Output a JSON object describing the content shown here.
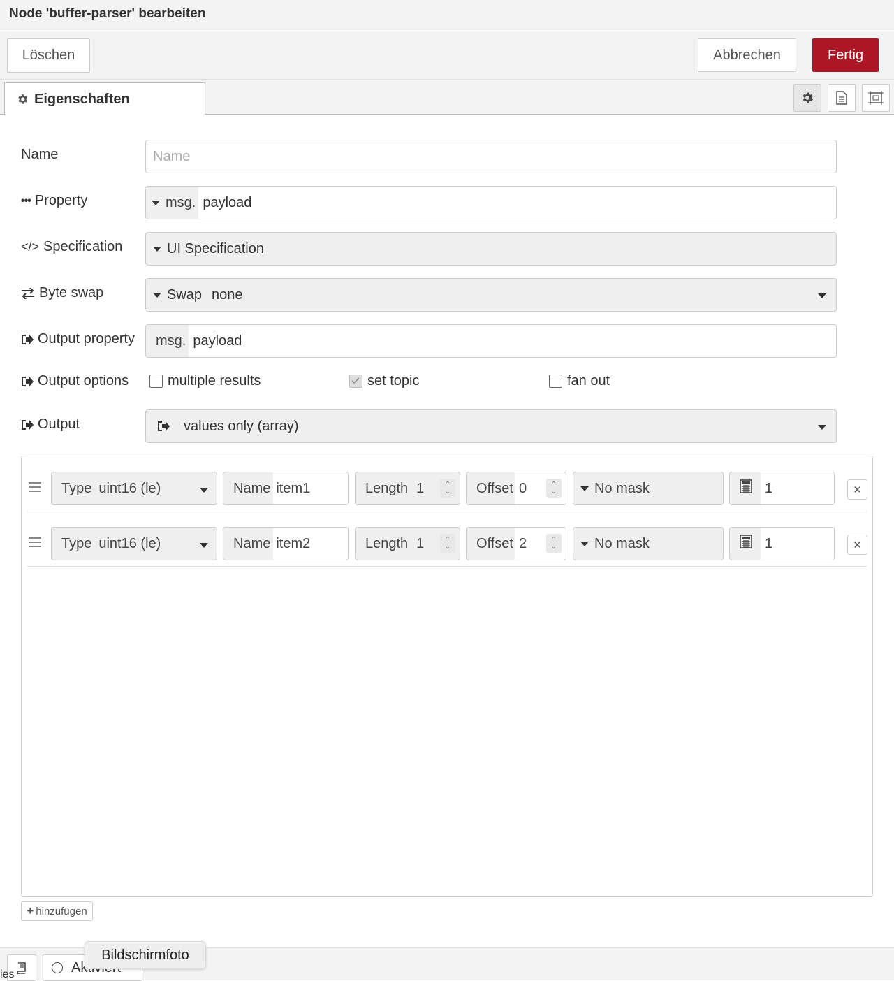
{
  "window": {
    "title": "Node 'buffer-parser' bearbeiten"
  },
  "toolbar": {
    "delete_label": "Löschen",
    "cancel_label": "Abbrechen",
    "done_label": "Fertig"
  },
  "tabs": {
    "properties_label": "Eigenschaften"
  },
  "form": {
    "name": {
      "label": "Name",
      "placeholder": "Name",
      "value": ""
    },
    "property": {
      "label": "Property",
      "prefix": "msg.",
      "value": "payload"
    },
    "specification": {
      "label": "Specification",
      "value": "UI Specification"
    },
    "byte_swap": {
      "label": "Byte swap",
      "prefix": "Swap",
      "value": "none"
    },
    "output_property": {
      "label": "Output property",
      "prefix": "msg.",
      "value": "payload"
    },
    "output_options": {
      "label": "Output options",
      "multiple_results": {
        "label": "multiple results",
        "checked": false
      },
      "set_topic": {
        "label": "set topic",
        "checked": true
      },
      "fan_out": {
        "label": "fan out",
        "checked": false
      }
    },
    "output": {
      "label": "Output",
      "value": "values only (array)"
    }
  },
  "items": [
    {
      "type_label": "Type",
      "type_value": "uint16 (le)",
      "name_label": "Name",
      "name_value": "item1",
      "length_label": "Length",
      "length_value": "1",
      "offset_label": "Offset",
      "offset_value": "0",
      "mask_value": "No mask",
      "scale_value": "1"
    },
    {
      "type_label": "Type",
      "type_value": "uint16 (le)",
      "name_label": "Name",
      "name_value": "item2",
      "length_label": "Length",
      "length_value": "1",
      "offset_label": "Offset",
      "offset_value": "2",
      "mask_value": "No mask",
      "scale_value": "1"
    }
  ],
  "list": {
    "add_label": "hinzufügen"
  },
  "footer": {
    "left_fragment": "ies",
    "status_label": "Aktiviert",
    "tooltip": "Bildschirmfoto"
  },
  "colors": {
    "primary": "#ad1625",
    "panel_bg": "#f3f3f3",
    "border": "#cccccc"
  },
  "icons": [
    "gear-icon",
    "document-icon",
    "frame-icon",
    "ellipsis-icon",
    "code-icon",
    "swap-arrows-icon",
    "output-arrow-icon",
    "drag-handle-icon",
    "calculator-icon",
    "close-icon",
    "plus-icon",
    "book-icon",
    "circle-icon"
  ]
}
